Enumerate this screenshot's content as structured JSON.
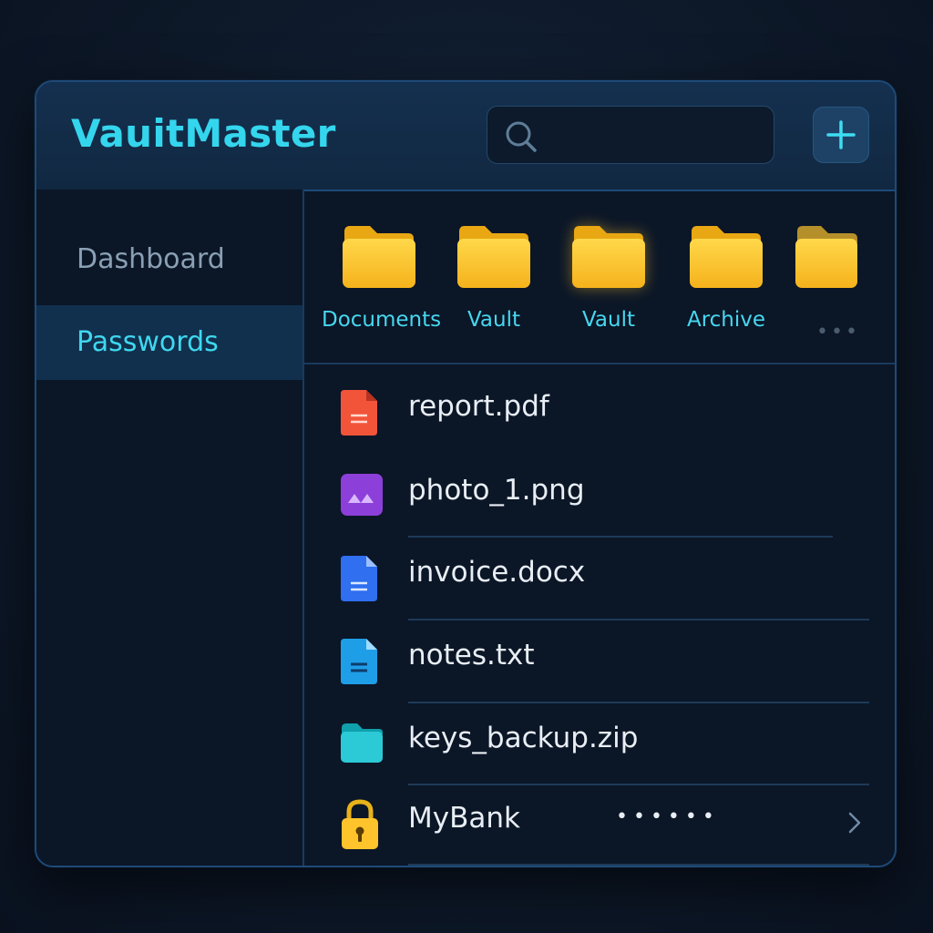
{
  "app": {
    "title": "VauitMaster"
  },
  "search": {
    "placeholder": "",
    "value": "",
    "icon": "search-icon"
  },
  "toolbar": {
    "add_icon": "plus-icon"
  },
  "sidebar": {
    "items": [
      {
        "label": "Dashboard",
        "active": false
      },
      {
        "label": "Passwords",
        "active": true
      }
    ]
  },
  "folders": [
    {
      "label": "Documents",
      "icon": "folder-icon"
    },
    {
      "label": "Vault",
      "icon": "folder-icon"
    },
    {
      "label": "Vault",
      "icon": "folder-icon"
    },
    {
      "label": "Archive",
      "icon": "folder-icon"
    },
    {
      "label": "",
      "icon": "folder-icon"
    }
  ],
  "files": [
    {
      "name": "report.pdf",
      "icon": "pdf-file-icon"
    },
    {
      "name": "photo_1.png",
      "icon": "image-file-icon"
    },
    {
      "name": "invoice.docx",
      "icon": "doc-file-icon"
    },
    {
      "name": "notes.txt",
      "icon": "text-file-icon"
    },
    {
      "name": "keys_backup.zip",
      "icon": "zip-folder-icon"
    },
    {
      "name": "MyBank",
      "icon": "lock-icon",
      "masked_password": "••••••"
    }
  ],
  "colors": {
    "accent": "#34d6ee",
    "folder": "#ffc42b",
    "background": "#0b1627"
  }
}
